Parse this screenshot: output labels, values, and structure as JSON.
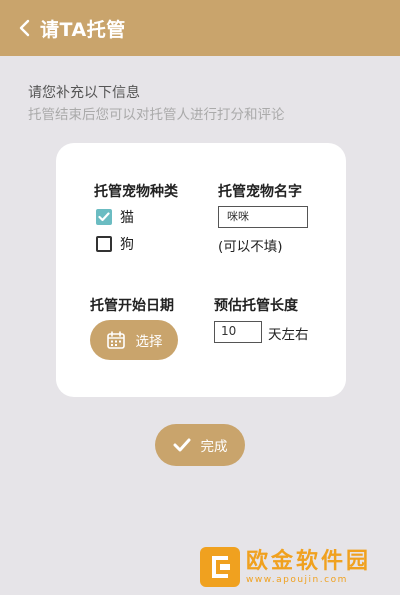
{
  "header": {
    "title": "请TA托管"
  },
  "info": {
    "title": "请您补充以下信息",
    "subtitle": "托管结束后您可以对托管人进行打分和评论"
  },
  "pet_type": {
    "label": "托管宠物种类",
    "options": [
      {
        "label": "猫",
        "checked": true
      },
      {
        "label": "狗",
        "checked": false
      }
    ]
  },
  "pet_name": {
    "label": "托管宠物名字",
    "value": "咪咪",
    "hint": "(可以不填)"
  },
  "start_date": {
    "label": "托管开始日期",
    "button_label": "选择"
  },
  "duration": {
    "label": "预估托管长度",
    "value": "10",
    "unit": "天左右"
  },
  "done": {
    "label": "完成"
  },
  "watermark": {
    "text": "欧金软件园",
    "url": "www.apoujin.com"
  },
  "colors": {
    "accent": "#c9a46c",
    "check": "#6bbcc2",
    "background": "#e6e4e8",
    "watermark": "#f0a11f"
  }
}
